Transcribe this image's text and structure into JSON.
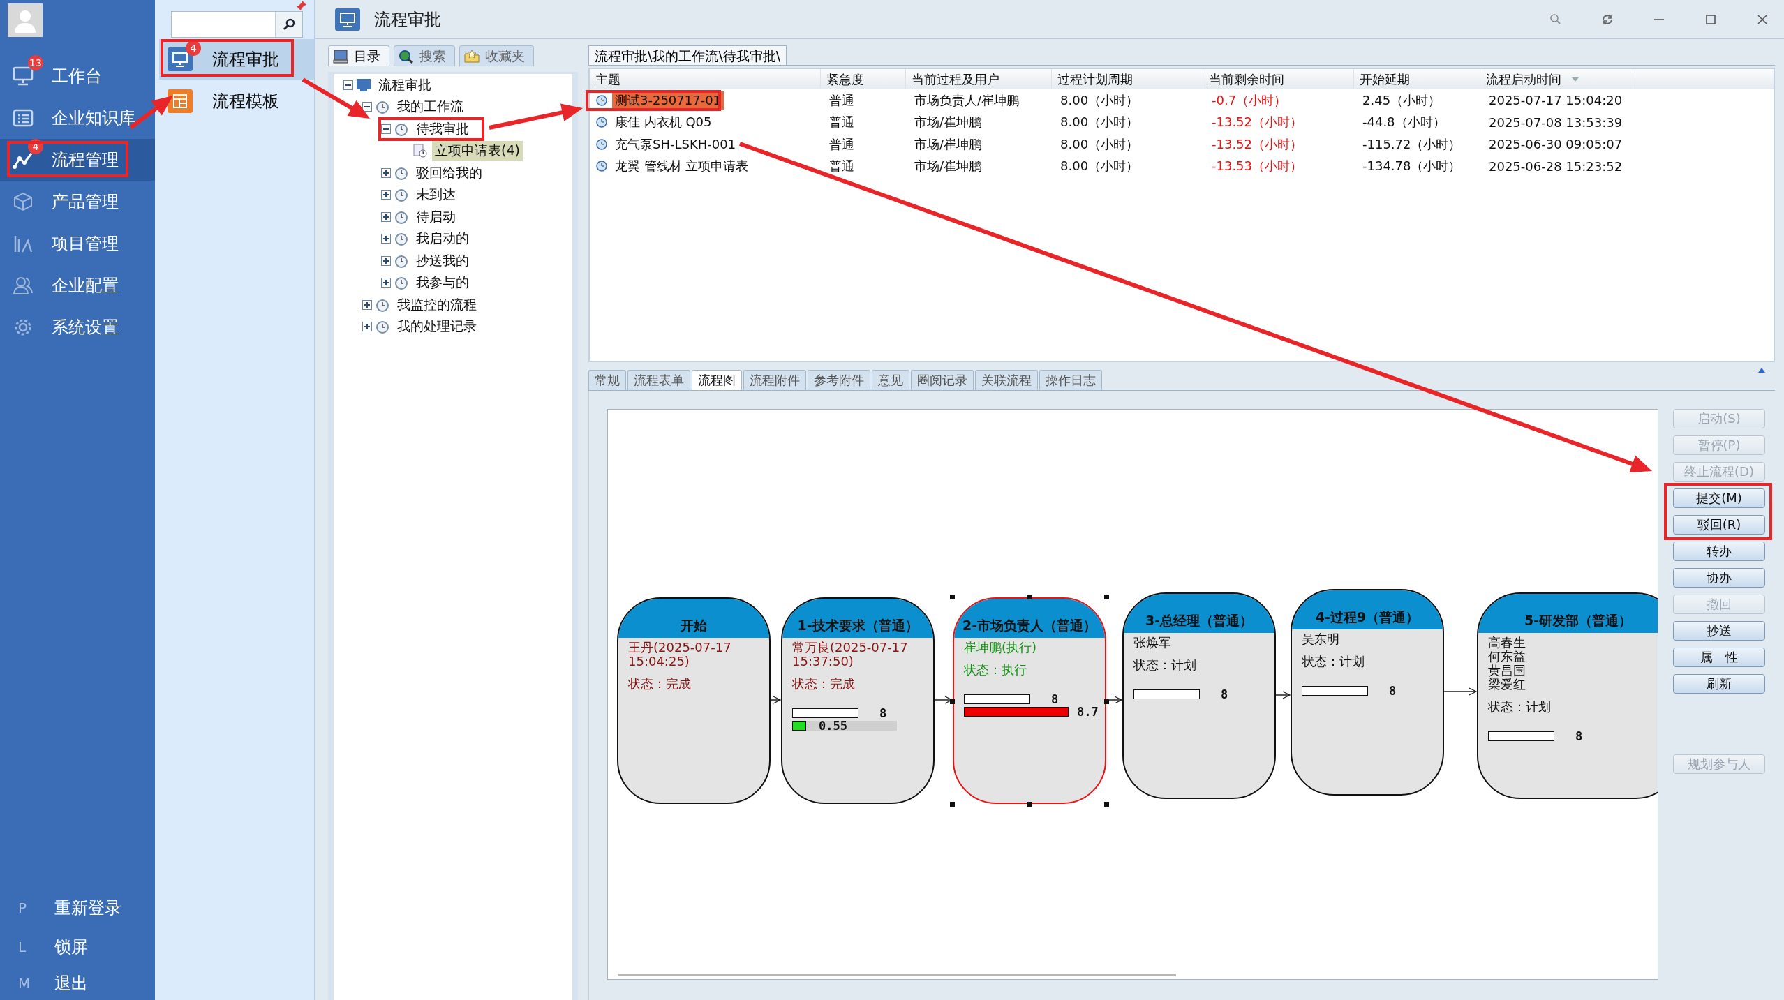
{
  "sidebar": {
    "items": [
      {
        "label": "工作台",
        "badge": "13",
        "selected": false
      },
      {
        "label": "企业知识库",
        "selected": false
      },
      {
        "label": "流程管理",
        "badge": "4",
        "selected": true
      },
      {
        "label": "产品管理",
        "selected": false
      },
      {
        "label": "项目管理",
        "selected": false
      },
      {
        "label": "企业配置",
        "selected": false
      },
      {
        "label": "系统设置",
        "selected": false
      }
    ],
    "bottom_items": [
      {
        "key": "P",
        "label": "重新登录"
      },
      {
        "key": "L",
        "label": "锁屏"
      },
      {
        "key": "M",
        "label": "退出"
      }
    ]
  },
  "subpanel": {
    "items": [
      {
        "label": "流程审批",
        "badge": "4",
        "selected": true
      },
      {
        "label": "流程模板",
        "selected": false
      }
    ]
  },
  "window": {
    "title": "流程审批"
  },
  "nav_tabs": [
    {
      "label": "目录",
      "selected": true
    },
    {
      "label": "搜索",
      "selected": false
    },
    {
      "label": "收藏夹",
      "selected": false
    }
  ],
  "tree": [
    {
      "label": "流程审批",
      "expanded": true,
      "selected": false,
      "children": [
        {
          "label": "我的工作流",
          "expanded": true,
          "selected": false,
          "children": [
            {
              "label": "待我审批",
              "expanded": true,
              "selected": false,
              "children": [
                {
                  "label": "立项申请表(4)",
                  "selected": true
                }
              ]
            },
            {
              "label": "驳回给我的",
              "expanded": false,
              "selected": false
            },
            {
              "label": "未到达",
              "expanded": false,
              "selected": false
            },
            {
              "label": "待启动",
              "expanded": false,
              "selected": false
            },
            {
              "label": "我启动的",
              "expanded": false,
              "selected": false
            },
            {
              "label": "抄送我的",
              "expanded": false,
              "selected": false
            },
            {
              "label": "我参与的",
              "expanded": false,
              "selected": false
            }
          ]
        },
        {
          "label": "我监控的流程",
          "expanded": false,
          "selected": false
        },
        {
          "label": "我的处理记录",
          "expanded": false,
          "selected": false
        }
      ]
    }
  ],
  "breadcrumb_tab": "流程审批\\我的工作流\\待我审批\\",
  "table": {
    "columns": [
      "主题",
      "紧急度",
      "当前过程及用户",
      "过程计划周期",
      "当前剩余时间",
      "开始延期",
      "流程启动时间"
    ],
    "rows": [
      {
        "subject": "测试3-250717-01",
        "urgency": "普通",
        "current_step": "市场负责人/崔坤鹏",
        "plan_period": "8.00（小时）",
        "remaining": "-0.7（小时）",
        "delay": "2.45（小时）",
        "start_time": "2025-07-17 15:04:20",
        "overdue": true,
        "selected": true
      },
      {
        "subject": "康佳 内衣机 Q05",
        "urgency": "普通",
        "current_step": "市场/崔坤鹏",
        "plan_period": "8.00（小时）",
        "remaining": "-13.52（小时）",
        "delay": "-44.8（小时）",
        "start_time": "2025-07-08 13:53:39",
        "overdue": true,
        "selected": false
      },
      {
        "subject": "充气泵SH-LSKH-001",
        "urgency": "普通",
        "current_step": "市场/崔坤鹏",
        "plan_period": "8.00（小时）",
        "remaining": "-13.52（小时）",
        "delay": "-115.72（小时）",
        "start_time": "2025-06-30 09:05:07",
        "overdue": true,
        "selected": false
      },
      {
        "subject": "龙翼 管线材 立项申请表",
        "urgency": "普通",
        "current_step": "市场/崔坤鹏",
        "plan_period": "8.00（小时）",
        "remaining": "-13.53（小时）",
        "delay": "-134.78（小时）",
        "start_time": "2025-06-28 15:23:52",
        "overdue": true,
        "selected": false
      }
    ]
  },
  "detail_tabs": [
    {
      "label": "常规",
      "selected": false
    },
    {
      "label": "流程表单",
      "selected": false
    },
    {
      "label": "流程图",
      "selected": true
    },
    {
      "label": "流程附件",
      "selected": false
    },
    {
      "label": "参考附件",
      "selected": false
    },
    {
      "label": "意见",
      "selected": false
    },
    {
      "label": "圈阅记录",
      "selected": false
    },
    {
      "label": "关联流程",
      "selected": false
    },
    {
      "label": "操作日志",
      "selected": false
    }
  ],
  "flow": {
    "nodes": [
      {
        "title": "开始",
        "kind": "done",
        "selected": false,
        "people": [
          "王丹(2025-07-17 15:04:25)"
        ],
        "status": "状态：完成"
      },
      {
        "title": "1-技术要求（普通）",
        "kind": "done",
        "selected": false,
        "people": [
          "常万良(2025-07-17 15:37:50)"
        ],
        "status": "状态：完成",
        "plan_bar": "8",
        "actual_bar": {
          "value": "0.55",
          "level": 0.13,
          "kind": "normal"
        }
      },
      {
        "title": "2-市场负责人（普通）",
        "kind": "active",
        "selected": true,
        "people": [
          "崔坤鹏(执行)"
        ],
        "status": "状态：执行",
        "plan_bar": "8",
        "actual_bar": {
          "value": "8.7",
          "level": 1,
          "kind": "overdue"
        }
      },
      {
        "title": "3-总经理（普通）",
        "kind": "planned",
        "selected": false,
        "people": [
          "张焕军"
        ],
        "status": "状态：计划",
        "plan_bar": "8"
      },
      {
        "title": "4-过程9（普通）",
        "kind": "planned",
        "selected": false,
        "people": [
          "吴东明"
        ],
        "status": "状态：计划",
        "plan_bar": "8"
      },
      {
        "title": "5-研发部（普通）",
        "kind": "planned",
        "selected": false,
        "people": [
          "高春生",
          "何东益",
          "黄昌国",
          "梁爱红"
        ],
        "status": "状态：计划",
        "plan_bar": "8"
      }
    ]
  },
  "actions": [
    {
      "label": "启动(S)",
      "disabled": true
    },
    {
      "label": "暂停(P)",
      "disabled": true
    },
    {
      "label": "终止流程(D)",
      "disabled": true
    },
    {
      "label": "提交(M)",
      "disabled": false
    },
    {
      "label": "驳回(R)",
      "disabled": false
    },
    {
      "label": "转办",
      "disabled": false
    },
    {
      "label": "协办",
      "disabled": false
    },
    {
      "label": "撤回",
      "disabled": true
    },
    {
      "label": "抄送",
      "disabled": false
    },
    {
      "label": "属　性",
      "disabled": false
    },
    {
      "label": "刷新",
      "disabled": false
    },
    {
      "label": "规划参与人",
      "disabled": true
    }
  ]
}
